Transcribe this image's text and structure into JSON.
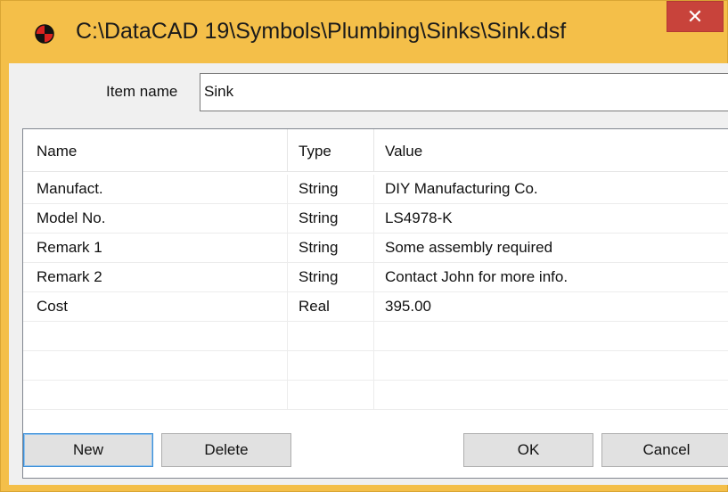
{
  "window": {
    "title": "C:\\DataCAD 19\\Symbols\\Plumbing\\Sinks\\Sink.dsf",
    "close_glyph": "✕",
    "icon": "datacad-app-icon"
  },
  "item": {
    "label": "Item name",
    "value": "Sink"
  },
  "table": {
    "headers": [
      "Name",
      "Type",
      "Value"
    ],
    "rows": [
      {
        "name": "Manufact.",
        "type": "String",
        "value": "DIY Manufacturing Co."
      },
      {
        "name": "Model No.",
        "type": "String",
        "value": "LS4978-K"
      },
      {
        "name": "Remark 1",
        "type": "String",
        "value": "Some assembly required"
      },
      {
        "name": "Remark 2",
        "type": "String",
        "value": "Contact John for more info."
      },
      {
        "name": "Cost",
        "type": "Real",
        "value": "395.00"
      }
    ]
  },
  "buttons": {
    "new": "New",
    "delete": "Delete",
    "ok": "OK",
    "cancel": "Cancel"
  },
  "colors": {
    "frame": "#f4bf49",
    "close": "#c8433b"
  }
}
